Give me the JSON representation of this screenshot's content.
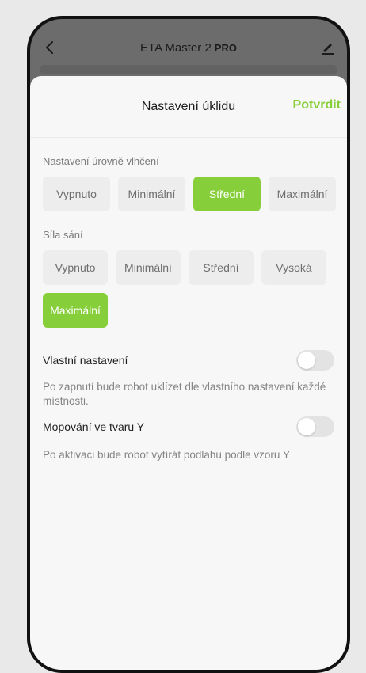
{
  "appbar": {
    "title": "ETA Master 2",
    "badge": "PRO",
    "back_icon": "chevron-left-icon",
    "edit_icon": "pencil-icon"
  },
  "sheet": {
    "title": "Nastavení úklidu",
    "confirm_label": "Potvrdit"
  },
  "humidity": {
    "label": "Nastavení úrovně vlhčení",
    "options": [
      "Vypnuto",
      "Minimální",
      "Střední",
      "Maximální"
    ],
    "selected": "Střední"
  },
  "suction": {
    "label": "Síla sání",
    "options": [
      "Vypnuto",
      "Minimální",
      "Střední",
      "Vysoká",
      "Maximální"
    ],
    "selected": "Maximální"
  },
  "custom_settings": {
    "label": "Vlastní nastavení",
    "enabled": false,
    "description": "Po zapnutí bude robot uklízet dle vlastního nastavení každé místnosti."
  },
  "y_mopping": {
    "label": "Mopování ve tvaru Y",
    "enabled": false,
    "description": "Po aktivaci bude robot vytírát podlahu podle vzoru Y"
  },
  "colors": {
    "accent": "#86cf3a",
    "chip_bg": "#ededed",
    "toggle_off": "#e3e3e3"
  }
}
